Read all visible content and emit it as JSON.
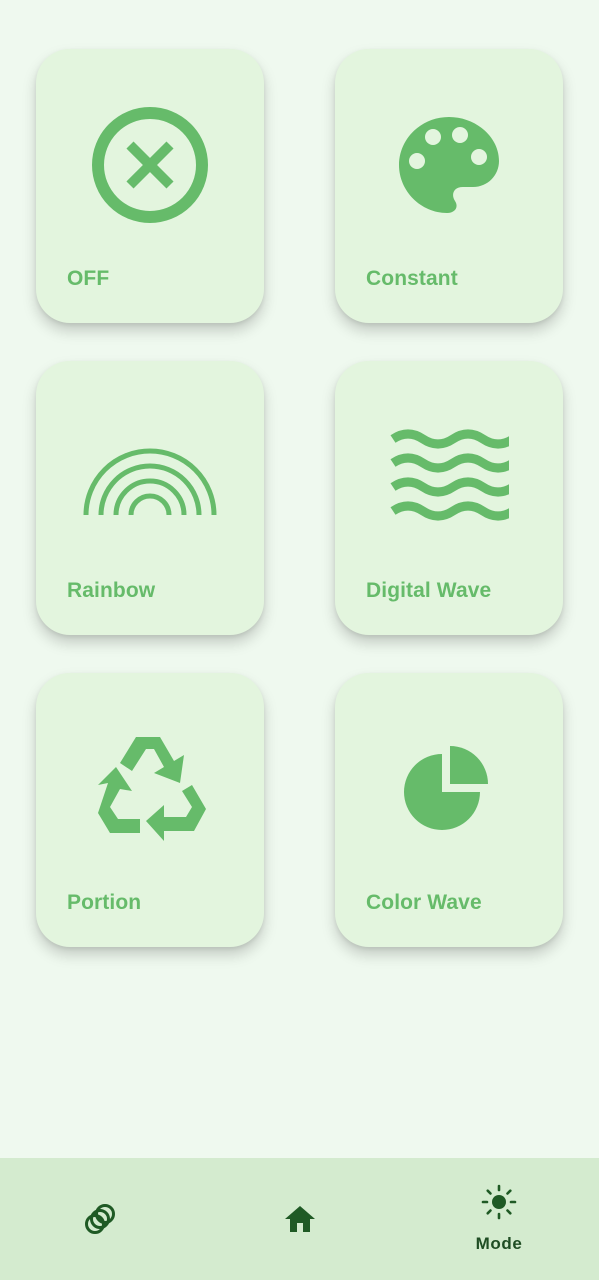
{
  "modes": [
    {
      "label": "OFF",
      "icon": "close-circle-icon"
    },
    {
      "label": "Constant",
      "icon": "palette-icon"
    },
    {
      "label": "Rainbow",
      "icon": "rainbow-icon"
    },
    {
      "label": "Digital Wave",
      "icon": "waves-icon"
    },
    {
      "label": "Portion",
      "icon": "recycle-icon"
    },
    {
      "label": "Color Wave",
      "icon": "pie-chart-icon"
    }
  ],
  "bottom_nav": {
    "items": [
      {
        "icon": "rings-icon",
        "label": ""
      },
      {
        "icon": "home-icon",
        "label": ""
      },
      {
        "icon": "sun-icon",
        "label": "Mode",
        "selected": true
      }
    ]
  },
  "colors": {
    "accent": "#66bb6a",
    "card_bg": "#e3f5de",
    "page_bg": "#eff9ef",
    "nav_bg": "#d4ebcf",
    "nav_icon": "#1f5a25"
  }
}
